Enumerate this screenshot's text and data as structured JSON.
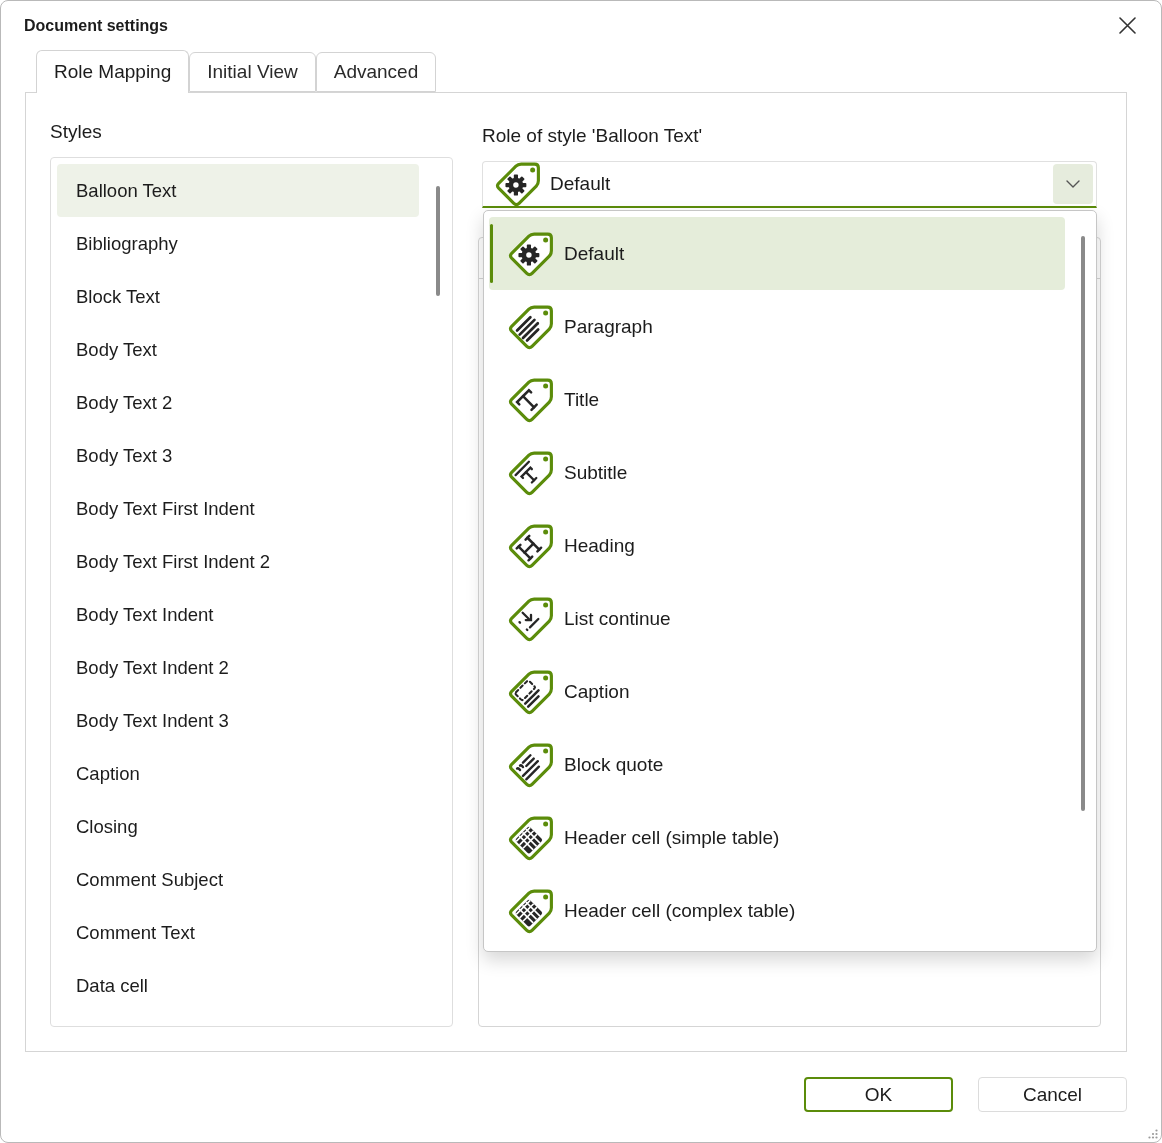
{
  "window": {
    "title": "Document settings"
  },
  "tabs": [
    {
      "label": "Role Mapping",
      "selected": true
    },
    {
      "label": "Initial View",
      "selected": false
    },
    {
      "label": "Advanced",
      "selected": false
    }
  ],
  "styles": {
    "label": "Styles",
    "items": [
      {
        "label": "Balloon Text",
        "selected": true
      },
      {
        "label": "Bibliography",
        "selected": false
      },
      {
        "label": "Block Text",
        "selected": false
      },
      {
        "label": "Body Text",
        "selected": false
      },
      {
        "label": "Body Text 2",
        "selected": false
      },
      {
        "label": "Body Text 3",
        "selected": false
      },
      {
        "label": "Body Text First Indent",
        "selected": false
      },
      {
        "label": "Body Text First Indent 2",
        "selected": false
      },
      {
        "label": "Body Text Indent",
        "selected": false
      },
      {
        "label": "Body Text Indent 2",
        "selected": false
      },
      {
        "label": "Body Text Indent 3",
        "selected": false
      },
      {
        "label": "Caption",
        "selected": false
      },
      {
        "label": "Closing",
        "selected": false
      },
      {
        "label": "Comment Subject",
        "selected": false
      },
      {
        "label": "Comment Text",
        "selected": false
      },
      {
        "label": "Data cell",
        "selected": false
      }
    ]
  },
  "role": {
    "label": "Role of style 'Balloon Text'",
    "value": {
      "label": "Default",
      "kind": "default"
    },
    "expanded": true,
    "options": [
      {
        "label": "Default",
        "kind": "default",
        "selected": true
      },
      {
        "label": "Paragraph",
        "kind": "paragraph",
        "selected": false
      },
      {
        "label": "Title",
        "kind": "title",
        "selected": false
      },
      {
        "label": "Subtitle",
        "kind": "subtitle",
        "selected": false
      },
      {
        "label": "Heading",
        "kind": "heading",
        "selected": false
      },
      {
        "label": "List continue",
        "kind": "list",
        "selected": false
      },
      {
        "label": "Caption",
        "kind": "caption",
        "selected": false
      },
      {
        "label": "Block quote",
        "kind": "quote",
        "selected": false
      },
      {
        "label": "Header cell (simple table)",
        "kind": "table",
        "selected": false
      },
      {
        "label": "Header cell (complex table)",
        "kind": "table",
        "selected": false
      }
    ]
  },
  "buttons": [
    {
      "label": "OK",
      "default": true
    },
    {
      "label": "Cancel",
      "default": false
    }
  ]
}
